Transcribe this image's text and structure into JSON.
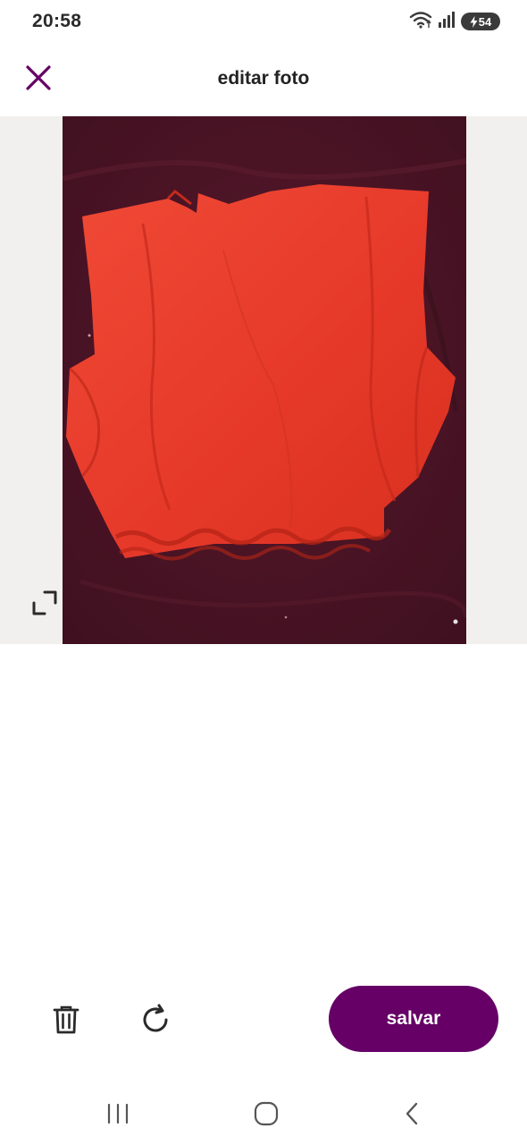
{
  "status_bar": {
    "time": "20:58",
    "battery_level": "54",
    "icons": [
      "wifi-icon",
      "signal-icon",
      "battery-charging-icon"
    ]
  },
  "header": {
    "title": "editar foto",
    "close_icon": "close-icon"
  },
  "photo": {
    "subject": "red sleeveless crop top on dark maroon fabric",
    "expand_icon": "expand-icon"
  },
  "toolbar": {
    "delete_icon": "trash-icon",
    "rotate_icon": "rotate-icon",
    "save_label": "salvar"
  },
  "nav_bar": {
    "icons": [
      "recent-apps-icon",
      "home-icon",
      "back-icon"
    ]
  },
  "colors": {
    "accent": "#660066",
    "photo_background": "#4a1424",
    "garment": "#e8392a",
    "page_background": "#ffffff",
    "photo_margin": "#f1f0ee"
  }
}
